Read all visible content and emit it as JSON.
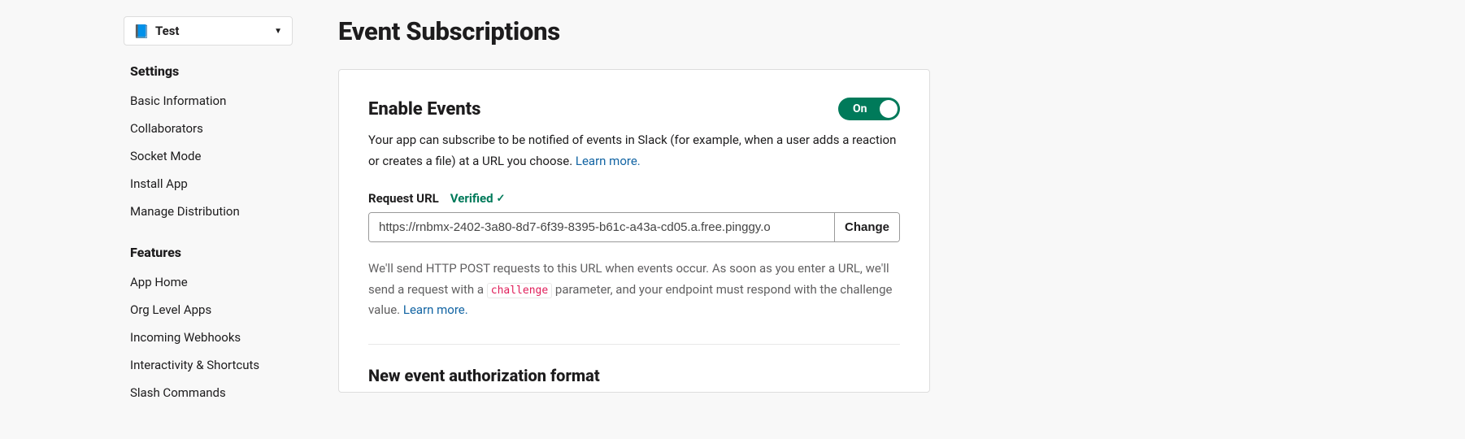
{
  "appSelector": {
    "name": "Test",
    "icon": "📘"
  },
  "sidebar": {
    "settingsHead": "Settings",
    "settings": [
      {
        "label": "Basic Information"
      },
      {
        "label": "Collaborators"
      },
      {
        "label": "Socket Mode"
      },
      {
        "label": "Install App"
      },
      {
        "label": "Manage Distribution"
      }
    ],
    "featuresHead": "Features",
    "features": [
      {
        "label": "App Home"
      },
      {
        "label": "Org Level Apps"
      },
      {
        "label": "Incoming Webhooks"
      },
      {
        "label": "Interactivity & Shortcuts"
      },
      {
        "label": "Slash Commands"
      }
    ]
  },
  "page": {
    "title": "Event Subscriptions"
  },
  "enable": {
    "title": "Enable Events",
    "toggleLabel": "On",
    "desc1": "Your app can subscribe to be notified of events in Slack (for example, when a user adds a reaction or creates a file) at a URL you choose. ",
    "learnMore": "Learn more.",
    "requestLabel": "Request URL",
    "verified": "Verified",
    "urlValue": "https://rnbmx-2402-3a80-8d7-6f39-8395-b61c-a43a-cd05.a.free.pinggy.o",
    "changeLabel": "Change",
    "helper1": "We'll send HTTP POST requests to this URL when events occur. As soon as you enter a URL, we'll send a request with a ",
    "challenge": "challenge",
    "helper2": " parameter, and your endpoint must respond with the challenge value. ",
    "learnMore2": "Learn more."
  },
  "auth": {
    "title": "New event authorization format"
  }
}
